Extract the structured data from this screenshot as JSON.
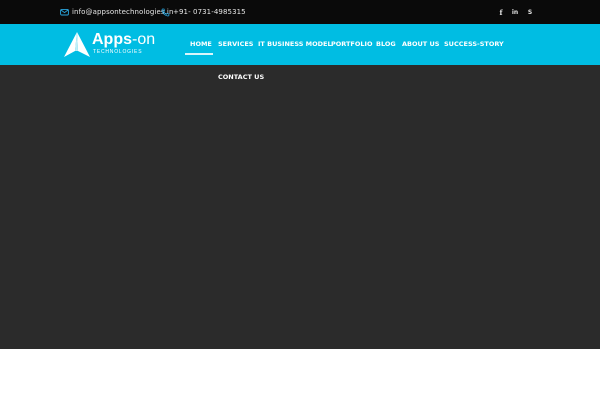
{
  "topbar": {
    "email": "info@appsontechnologies.in",
    "phone": "+91- 0731-4985315",
    "social": [
      {
        "icon": "facebook-icon",
        "glyph": "f"
      },
      {
        "icon": "linkedin-icon",
        "glyph": "in"
      },
      {
        "icon": "skype-icon",
        "glyph": "S"
      }
    ]
  },
  "logo": {
    "brand_main": "Apps",
    "brand_suffix": "-on",
    "subtitle": "TECHNOLOGIES"
  },
  "nav": {
    "items": [
      {
        "label": "HOME",
        "active": true
      },
      {
        "label": "SERVICES"
      },
      {
        "label": "IT BUSINESS MODEL"
      },
      {
        "label": "PORTFOLIO"
      },
      {
        "label": "BLOG"
      },
      {
        "label": "ABOUT US"
      },
      {
        "label": "SUCCESS-STORY"
      },
      {
        "label": "CONTACT US"
      }
    ]
  },
  "colors": {
    "topbar_bg": "#0a0a0a",
    "navbar_bg": "#00bde3",
    "hero_bg": "#2b2b2b",
    "accent_icon": "#2aa7e0"
  }
}
